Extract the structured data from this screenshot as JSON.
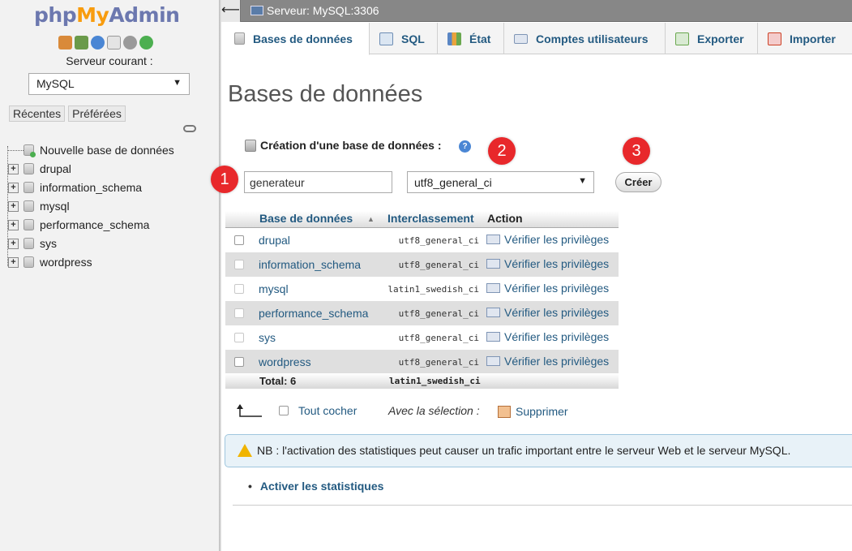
{
  "sidebar": {
    "logo": {
      "php": "php",
      "my": "My",
      "admin": "Admin"
    },
    "quick_icons": [
      "home-icon",
      "exit-icon",
      "help-icon",
      "docs-icon",
      "settings-icon",
      "reload-icon"
    ],
    "server_label": "Serveur courant :",
    "server_value": "MySQL",
    "tabs": [
      "Récentes",
      "Préférées"
    ],
    "new_db": "Nouvelle base de données",
    "databases": [
      "drupal",
      "information_schema",
      "mysql",
      "performance_schema",
      "sys",
      "wordpress"
    ]
  },
  "topbar": {
    "back": "⟵",
    "breadcrumb": "Serveur: MySQL:3306"
  },
  "tabs": [
    {
      "label": "Bases de données",
      "icon": "database-icon",
      "active": true
    },
    {
      "label": "SQL",
      "icon": "sql-icon"
    },
    {
      "label": "État",
      "icon": "status-icon"
    },
    {
      "label": "Comptes utilisateurs",
      "icon": "users-icon"
    },
    {
      "label": "Exporter",
      "icon": "export-icon"
    },
    {
      "label": "Importer",
      "icon": "import-icon"
    }
  ],
  "main": {
    "title": "Bases de données",
    "create_heading": "Création d'une base de données :",
    "help": "?",
    "badges": [
      "1",
      "2",
      "3"
    ],
    "db_name_value": "generateur",
    "collation_value": "utf8_general_ci",
    "create_button": "Créer",
    "table": {
      "headers": {
        "name": "Base de données",
        "collation": "Interclassement",
        "action": "Action"
      },
      "rows": [
        {
          "name": "drupal",
          "collation": "utf8_general_ci",
          "action": "Vérifier les privilèges"
        },
        {
          "name": "information_schema",
          "collation": "utf8_general_ci",
          "action": "Vérifier les privilèges"
        },
        {
          "name": "mysql",
          "collation": "latin1_swedish_ci",
          "action": "Vérifier les privilèges"
        },
        {
          "name": "performance_schema",
          "collation": "utf8_general_ci",
          "action": "Vérifier les privilèges"
        },
        {
          "name": "sys",
          "collation": "utf8_general_ci",
          "action": "Vérifier les privilèges"
        },
        {
          "name": "wordpress",
          "collation": "utf8_general_ci",
          "action": "Vérifier les privilèges"
        }
      ],
      "total_label": "Total: 6",
      "total_collation": "latin1_swedish_ci"
    },
    "check_all": "Tout cocher",
    "with_selection": "Avec la sélection :",
    "delete": "Supprimer",
    "notice": "NB : l'activation des statistiques peut causer un trafic important entre le serveur Web et le serveur MySQL.",
    "enable_stats": "Activer les statistiques"
  },
  "colors": {
    "link": "#235a81",
    "badge": "#e8282b",
    "sidebar_bg": "#f2f2f2",
    "topbar_bg": "#878787"
  }
}
